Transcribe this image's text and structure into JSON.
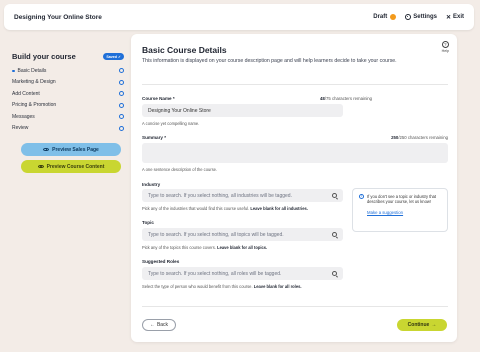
{
  "topbar": {
    "title": "Designing Your Online Store",
    "draft_label": "Draft",
    "settings_label": "Settings",
    "exit_label": "Exit",
    "draft_color": "#f39a1b"
  },
  "sidebar": {
    "title": "Build your course",
    "badge": "Saved ✓",
    "items": [
      {
        "label": "Basic Details",
        "active": true
      },
      {
        "label": "Marketing & Design",
        "active": false
      },
      {
        "label": "Add Content",
        "active": false
      },
      {
        "label": "Pricing & Promotion",
        "active": false
      },
      {
        "label": "Messages",
        "active": false
      },
      {
        "label": "Review",
        "active": false
      }
    ],
    "preview_sales_label": "Preview Sales Page",
    "preview_content_label": "Preview Course Content"
  },
  "main": {
    "title": "Basic Course Details",
    "description": "This information is displayed on your course description page and will help learners decide to take your course.",
    "help_label": "Help",
    "course_name": {
      "label": "Course Name *",
      "value": "Designing Your Online Store",
      "counter_value": "48",
      "counter_text": "/75 characters remaining",
      "hint": "A concise yet compelling name."
    },
    "summary": {
      "label": "Summary *",
      "value": "",
      "counter_value": "250",
      "counter_text": "/250 characters remaining",
      "hint": "A one sentence description of the course."
    },
    "industry": {
      "label": "Industry",
      "placeholder": "Type to search. If you select nothing, all industries will be tagged.",
      "hint_main": "Pick any of the industries that would find this course useful.",
      "hint_bold": "Leave blank for all industries."
    },
    "topic": {
      "label": "Topic",
      "placeholder": "Type to search. If you select nothing, all topics will be tagged.",
      "hint_main": "Pick any of the topics this course covers.",
      "hint_bold": "Leave blank for all topics."
    },
    "roles": {
      "label": "Suggested Roles",
      "placeholder": "Type to search. If you select nothing, all roles will be tagged.",
      "hint_main": "Select the type of person who would benefit from this course.",
      "hint_bold": "Leave blank for all roles."
    },
    "info": {
      "text": "If you don't see a topic or industry that describes your course, let us know!",
      "link": "Make a suggestion"
    },
    "back_label": "Back",
    "continue_label": "Continue"
  }
}
